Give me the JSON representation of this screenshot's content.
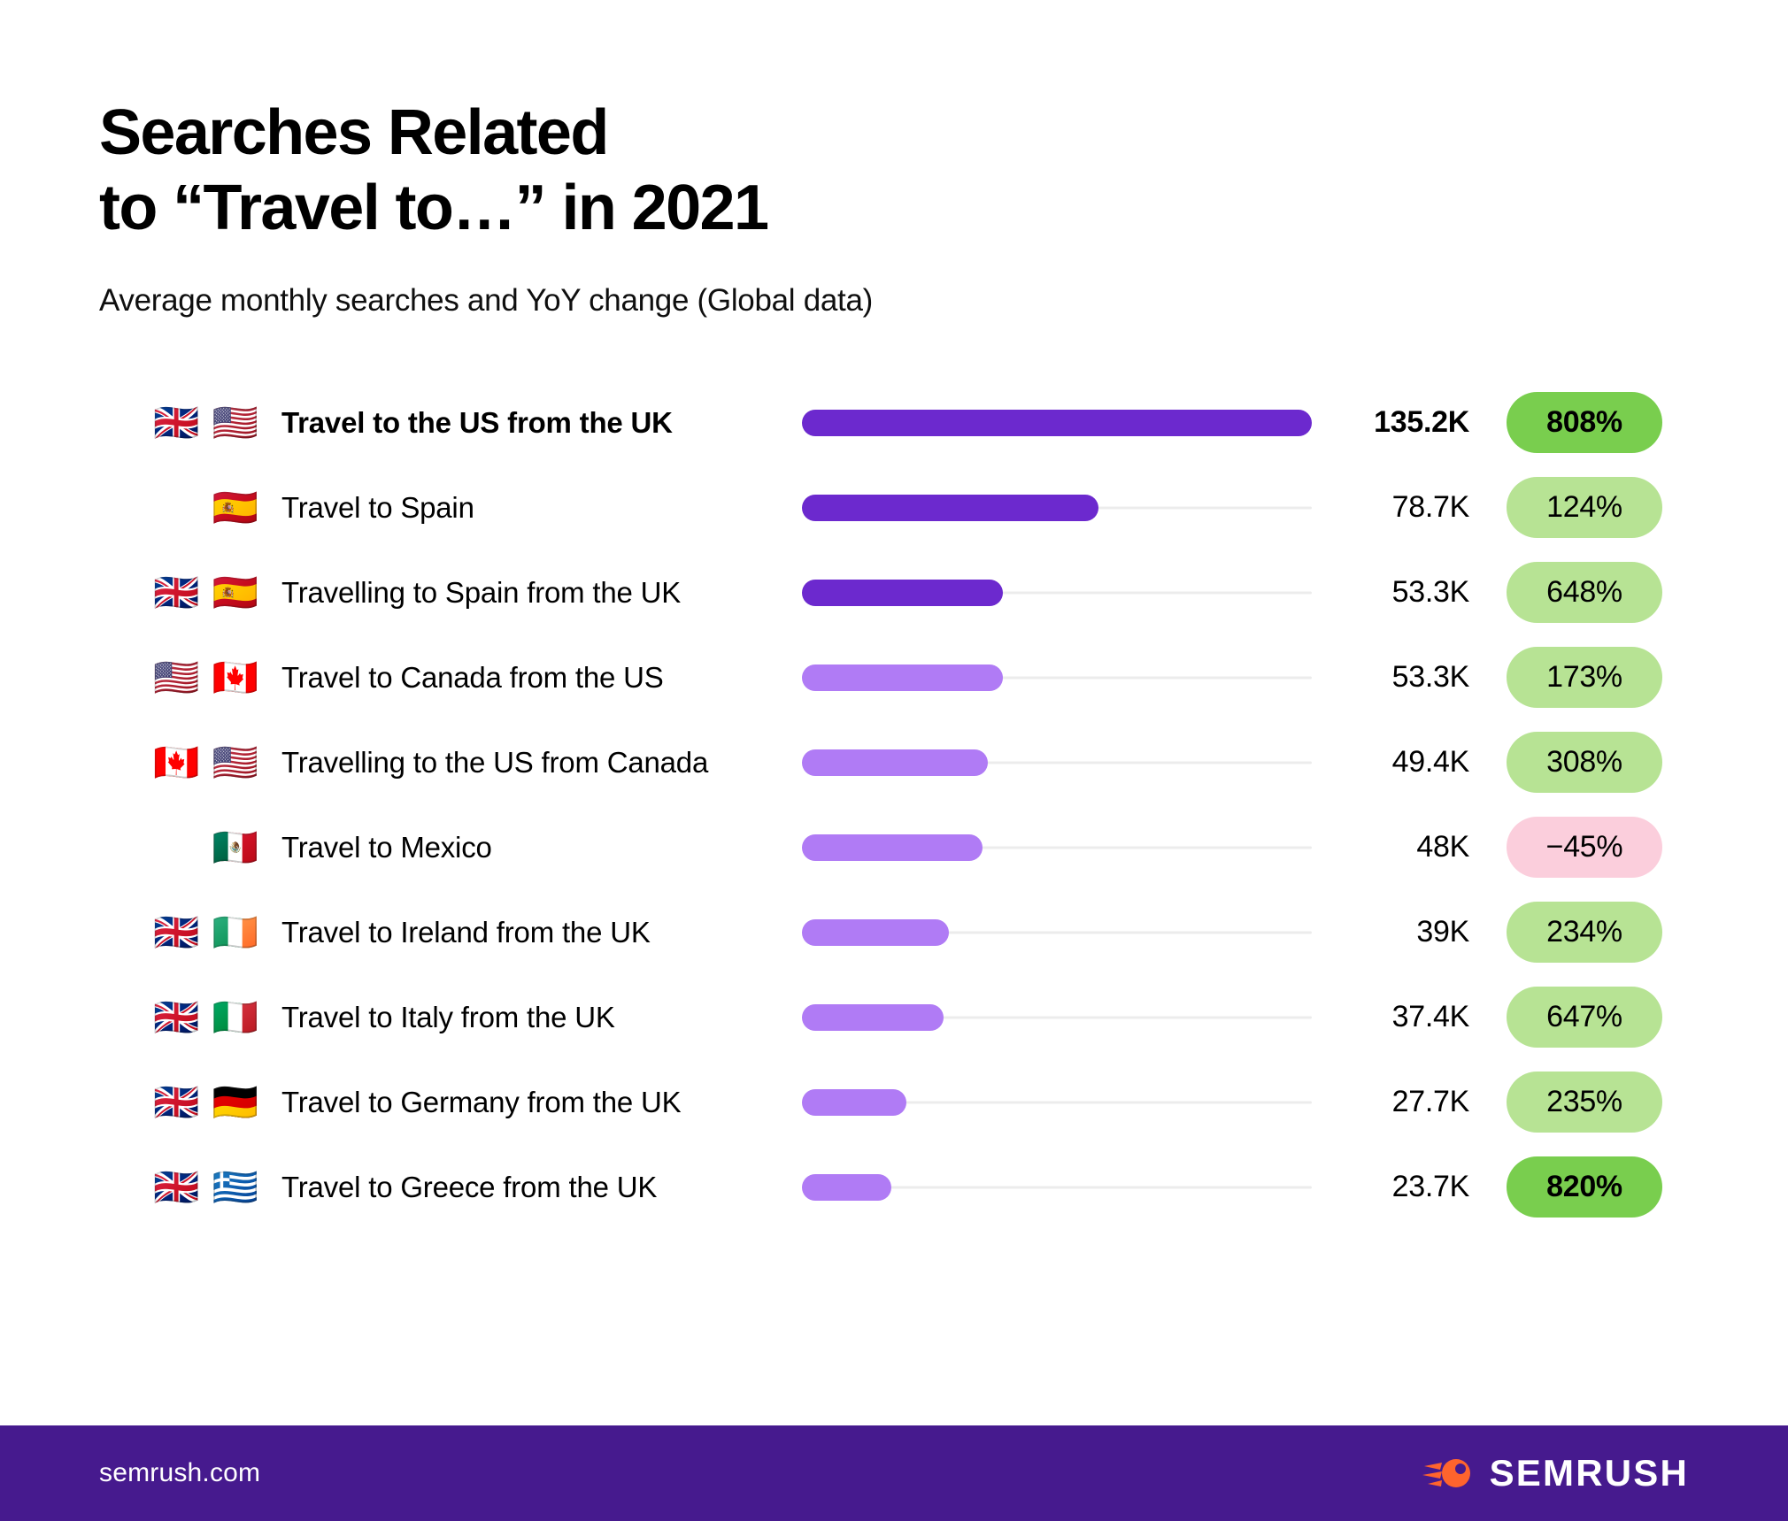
{
  "header": {
    "title": "Searches Related\nto “Travel to…” in 2021",
    "subtitle": "Average monthly searches and YoY change (Global data)"
  },
  "footer": {
    "url": "semrush.com",
    "brand_name": "SEMRUSH",
    "brand_icon": "semrush-comet-logo",
    "background_color": "#461A8E",
    "logo_color": "#FF642D"
  },
  "colors": {
    "bar_deep_purple": "#6C29CE",
    "bar_light_purple": "#B07BF5",
    "track": "#ECECEC",
    "badge_green": "#B7E394",
    "badge_green_strong": "#79CE4E",
    "badge_pink": "#FBCEDC"
  },
  "chart_data": {
    "type": "bar",
    "title": "Searches Related to “Travel to…” in 2021",
    "subtitle": "Average monthly searches and YoY change (Global data)",
    "xlabel": "",
    "ylabel": "",
    "orientation": "horizontal",
    "grid": false,
    "legend": false,
    "value_unit": "average monthly searches",
    "max_value": 135200,
    "categories": [
      "Travel to the US from the UK",
      "Travel to Spain",
      "Travelling to Spain from the UK",
      "Travel to Canada from the US",
      "Travelling to the US from Canada",
      "Travel to Mexico",
      "Travel to Ireland from the UK",
      "Travel to Italy from the UK",
      "Travel to Germany from the UK",
      "Travel to Greece from the UK"
    ],
    "values": [
      135200,
      78700,
      53300,
      53300,
      49400,
      48000,
      39000,
      37400,
      27700,
      23700
    ],
    "value_labels": [
      "135.2K",
      "78.7K",
      "53.3K",
      "53.3K",
      "49.4K",
      "48K",
      "39K",
      "37.4K",
      "27.7K",
      "23.7K"
    ],
    "yoy_change": [
      808,
      124,
      648,
      173,
      308,
      -45,
      234,
      647,
      235,
      820
    ],
    "yoy_labels": [
      "808%",
      "124%",
      "648%",
      "173%",
      "308%",
      "−45%",
      "234%",
      "647%",
      "235%",
      "820%"
    ]
  },
  "rows": [
    {
      "flags": [
        "🇬🇧",
        "🇺🇸"
      ],
      "flag_names": [
        "flag-uk",
        "flag-us"
      ],
      "label": "Travel to the US from the UK",
      "value": "135.2K",
      "bar_pct": 100,
      "bar_tone": "deep",
      "badge": "808%",
      "badge_tone": "strong",
      "emphasis": true
    },
    {
      "flags": [
        "🇪🇸"
      ],
      "flag_names": [
        "flag-spain"
      ],
      "label": "Travel to Spain",
      "value": "78.7K",
      "bar_pct": 58.2,
      "bar_tone": "deep",
      "badge": "124%",
      "badge_tone": "normal",
      "emphasis": false
    },
    {
      "flags": [
        "🇬🇧",
        "🇪🇸"
      ],
      "flag_names": [
        "flag-uk",
        "flag-spain"
      ],
      "label": "Travelling to Spain from the UK",
      "value": "53.3K",
      "bar_pct": 39.4,
      "bar_tone": "deep",
      "badge": "648%",
      "badge_tone": "normal",
      "emphasis": false
    },
    {
      "flags": [
        "🇺🇸",
        "🇨🇦"
      ],
      "flag_names": [
        "flag-us",
        "flag-canada"
      ],
      "label": "Travel to Canada from the US",
      "value": "53.3K",
      "bar_pct": 39.4,
      "bar_tone": "light",
      "badge": "173%",
      "badge_tone": "normal",
      "emphasis": false
    },
    {
      "flags": [
        "🇨🇦",
        "🇺🇸"
      ],
      "flag_names": [
        "flag-canada",
        "flag-us"
      ],
      "label": "Travelling to the US from Canada",
      "value": "49.4K",
      "bar_pct": 36.5,
      "bar_tone": "light",
      "badge": "308%",
      "badge_tone": "normal",
      "emphasis": false
    },
    {
      "flags": [
        "🇲🇽"
      ],
      "flag_names": [
        "flag-mexico"
      ],
      "label": "Travel to Mexico",
      "value": "48K",
      "bar_pct": 35.5,
      "bar_tone": "light",
      "badge": "−45%",
      "badge_tone": "negative",
      "emphasis": false
    },
    {
      "flags": [
        "🇬🇧",
        "🇮🇪"
      ],
      "flag_names": [
        "flag-uk",
        "flag-ireland"
      ],
      "label": "Travel to Ireland from the UK",
      "value": "39K",
      "bar_pct": 28.8,
      "bar_tone": "light",
      "badge": "234%",
      "badge_tone": "normal",
      "emphasis": false
    },
    {
      "flags": [
        "🇬🇧",
        "🇮🇹"
      ],
      "flag_names": [
        "flag-uk",
        "flag-italy"
      ],
      "label": "Travel to Italy from the UK",
      "value": "37.4K",
      "bar_pct": 27.7,
      "bar_tone": "light",
      "badge": "647%",
      "badge_tone": "normal",
      "emphasis": false
    },
    {
      "flags": [
        "🇬🇧",
        "🇩🇪"
      ],
      "flag_names": [
        "flag-uk",
        "flag-germany"
      ],
      "label": "Travel to Germany from the UK",
      "value": "27.7K",
      "bar_pct": 20.5,
      "bar_tone": "light",
      "badge": "235%",
      "badge_tone": "normal",
      "emphasis": false
    },
    {
      "flags": [
        "🇬🇧",
        "🇬🇷"
      ],
      "flag_names": [
        "flag-uk",
        "flag-greece"
      ],
      "label": "Travel to Greece from the UK",
      "value": "23.7K",
      "bar_pct": 17.5,
      "bar_tone": "light",
      "badge": "820%",
      "badge_tone": "strong",
      "emphasis": false
    }
  ]
}
